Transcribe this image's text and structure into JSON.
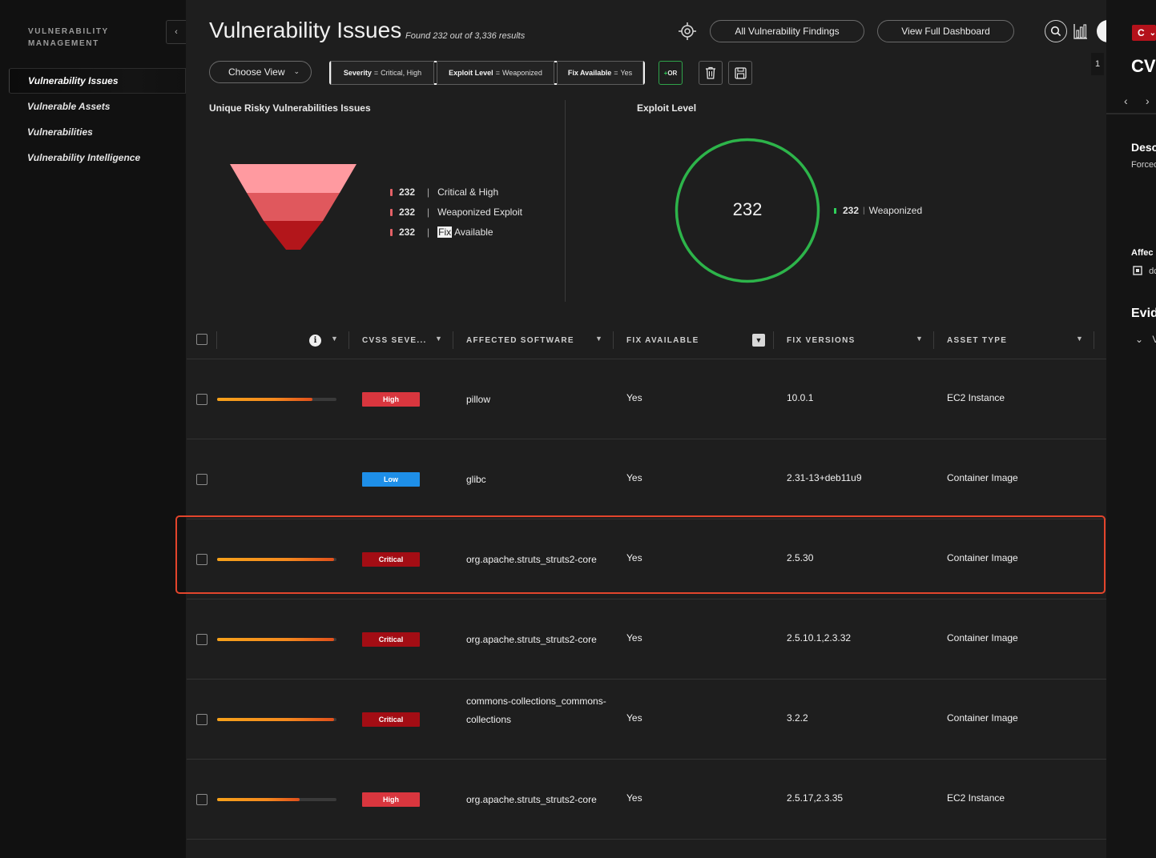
{
  "sidebar": {
    "title": "VULNERABILITY MANAGEMENT",
    "collapse_icon": "‹",
    "items": [
      {
        "label": "Vulnerability Issues",
        "active": true
      },
      {
        "label": "Vulnerable Assets"
      },
      {
        "label": "Vulnerabilities"
      },
      {
        "label": "Vulnerability Intelligence"
      }
    ]
  },
  "header": {
    "title": "Vulnerability Issues",
    "result_count": "Found 232 out of 3,336 results",
    "all_findings_label": "All Vulnerability Findings",
    "dashboard_label": "View Full Dashboard",
    "icons": [
      "target-icon",
      "search-icon",
      "bar-chart-icon"
    ]
  },
  "filters": {
    "choose_view_label": "Choose View",
    "chips": [
      {
        "field": "Severity",
        "op": "=",
        "value": "Critical, High"
      },
      {
        "field": "Exploit Level",
        "op": "=",
        "value": "Weaponized"
      },
      {
        "field": "Fix Available",
        "op": "=",
        "value": "Yes"
      }
    ],
    "or_label": "OR",
    "or_plus": "+",
    "icons": [
      "trash-icon",
      "save-icon"
    ]
  },
  "funnel_panel": {
    "title": "Unique Risky Vulnerabilities Issues",
    "legend": [
      {
        "count": "232",
        "label": "Critical & High"
      },
      {
        "count": "232",
        "label": "Weaponized Exploit"
      },
      {
        "count": "232",
        "label_prefix": "Fix",
        "label": "Available"
      }
    ],
    "colors": [
      "#ff9aa0",
      "#e0585d",
      "#b3161b"
    ]
  },
  "exploit_panel": {
    "title": "Exploit Level",
    "total": "232",
    "legend": {
      "count": "232",
      "label": "Weaponized",
      "color": "#2fd05a"
    }
  },
  "table": {
    "columns": [
      "CVSS SEVE...",
      "AFFECTED SOFTWARE",
      "FIX AVAILABLE",
      "FIX VERSIONS",
      "ASSET TYPE"
    ],
    "rows": [
      {
        "risk": 0.8,
        "severity": "High",
        "sev_color": "#d9363e",
        "software": "pillow",
        "fix": "Yes",
        "versions": "10.0.1",
        "asset": "EC2 Instance"
      },
      {
        "risk": null,
        "severity": "Low",
        "sev_color": "#1e8fe8",
        "software": "glibc",
        "fix": "Yes",
        "versions": "2.31-13+deb11u9",
        "asset": "Container Image"
      },
      {
        "risk": 0.98,
        "severity": "Critical",
        "sev_color": "#a30d14",
        "software": "org.apache.struts_struts2-core",
        "fix": "Yes",
        "versions": "2.5.30",
        "asset": "Container Image",
        "highlighted": true
      },
      {
        "risk": 0.98,
        "severity": "Critical",
        "sev_color": "#a30d14",
        "software": "org.apache.struts_struts2-core",
        "fix": "Yes",
        "versions": "2.5.10.1,2.3.32",
        "asset": "Container Image"
      },
      {
        "risk": 0.98,
        "severity": "Critical",
        "sev_color": "#a30d14",
        "software": "commons-collections_commons-collections",
        "fix": "Yes",
        "versions": "3.2.2",
        "asset": "Container Image"
      },
      {
        "risk": 0.69,
        "severity": "High",
        "sev_color": "#d9363e",
        "software": "org.apache.struts_struts2-core",
        "fix": "Yes",
        "versions": "2.5.17,2.3.35",
        "asset": "EC2 Instance"
      }
    ]
  },
  "side_panel": {
    "badge": "C",
    "badge_chevron": "⌄",
    "page_number": "1",
    "cve_title": "CVE",
    "prev_icon": "‹",
    "next_icon": "›",
    "desc_heading": "Desc",
    "desc_text": "Forced",
    "affected_heading": "Affec",
    "affected_text": "dc",
    "evidence_heading": "Evid",
    "evidence_chevron": "⌄",
    "evidence_text": "V"
  }
}
